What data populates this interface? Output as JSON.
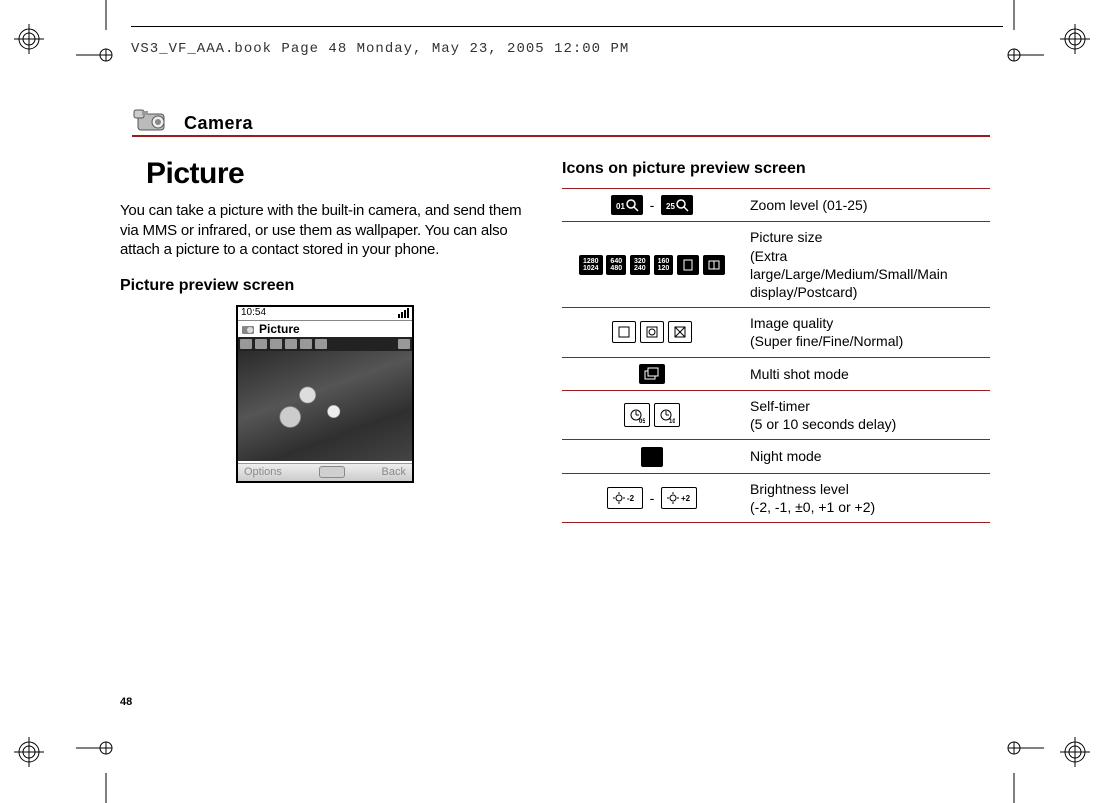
{
  "header": "VS3_VF_AAA.book  Page 48  Monday, May 23, 2005  12:00 PM",
  "section": "Camera",
  "title": "Picture",
  "intro": "You can take a picture with the built-in camera, and send them via MMS or infrared, or use them as wallpaper. You can also attach a picture to a contact stored in your phone.",
  "left_subhead": "Picture preview screen",
  "right_subhead": "Icons on picture preview screen",
  "phone": {
    "clock": "10:54",
    "title": "Picture",
    "soft_left": "Options",
    "soft_right": "Back"
  },
  "icons": {
    "zoom_low": "01",
    "zoom_high": "25",
    "zoom_desc": "Zoom level (01-25)",
    "size_desc_l1": "Picture size",
    "size_desc_l2": "(Extra large/Large/Medium/Small/Main display/Postcard)",
    "size_opts": [
      "1280\n1024",
      "640\n480",
      "320\n240",
      "160\n120"
    ],
    "quality_l1": "Image quality",
    "quality_l2": "(Super fine/Fine/Normal)",
    "multishot": "Multi shot mode",
    "timer_l1": "Self-timer",
    "timer_l2": "(5 or 10 seconds delay)",
    "timer_5": "05",
    "timer_10": "10",
    "night": "Night mode",
    "bright_l1": "Brightness level",
    "bright_l2": "(-2, -1, ±0, +1 or +2)",
    "bright_low": "-2",
    "bright_high": "+2"
  },
  "page_number": "48"
}
